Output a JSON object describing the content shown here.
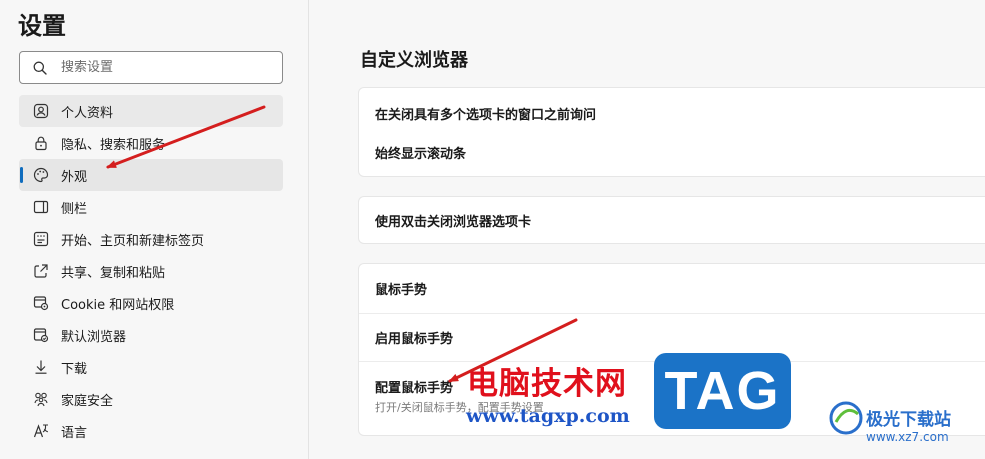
{
  "sidebar": {
    "title": "设置",
    "search_placeholder": "搜索设置",
    "items": [
      {
        "label": "个人资料",
        "icon": "profile-icon",
        "state": "hover"
      },
      {
        "label": "隐私、搜索和服务",
        "icon": "lock-icon",
        "state": ""
      },
      {
        "label": "外观",
        "icon": "palette-icon",
        "state": "selected"
      },
      {
        "label": "侧栏",
        "icon": "sidebar-icon",
        "state": ""
      },
      {
        "label": "开始、主页和新建标签页",
        "icon": "home-grid-icon",
        "state": ""
      },
      {
        "label": "共享、复制和粘贴",
        "icon": "share-icon",
        "state": ""
      },
      {
        "label": "Cookie 和网站权限",
        "icon": "cookie-icon",
        "state": ""
      },
      {
        "label": "默认浏览器",
        "icon": "browser-icon",
        "state": ""
      },
      {
        "label": "下载",
        "icon": "download-icon",
        "state": ""
      },
      {
        "label": "家庭安全",
        "icon": "family-icon",
        "state": ""
      },
      {
        "label": "语言",
        "icon": "language-icon",
        "state": ""
      }
    ]
  },
  "main": {
    "title": "自定义浏览器",
    "cards": {
      "tabs": {
        "ask_before_close": "在关闭具有多个选项卡的窗口之前询问",
        "always_show_scrollbar": "始终显示滚动条"
      },
      "double_click": {
        "label": "使用双击关闭浏览器选项卡"
      },
      "mouse_gestures": {
        "header": "鼠标手势",
        "enable": "启用鼠标手势",
        "configure": "配置鼠标手势",
        "description": "打开/关闭鼠标手势，配置手势设置"
      }
    }
  },
  "watermark": {
    "site_name_cn": "电脑技术网",
    "site_url": "www.tagxp.com",
    "badge": "TAG",
    "xz_name": "极光下载站",
    "xz_url": "www.xz7.com"
  },
  "colors": {
    "accent": "#0f6cbd",
    "arrow": "#d41e1e",
    "badge": "#1b73c7"
  }
}
